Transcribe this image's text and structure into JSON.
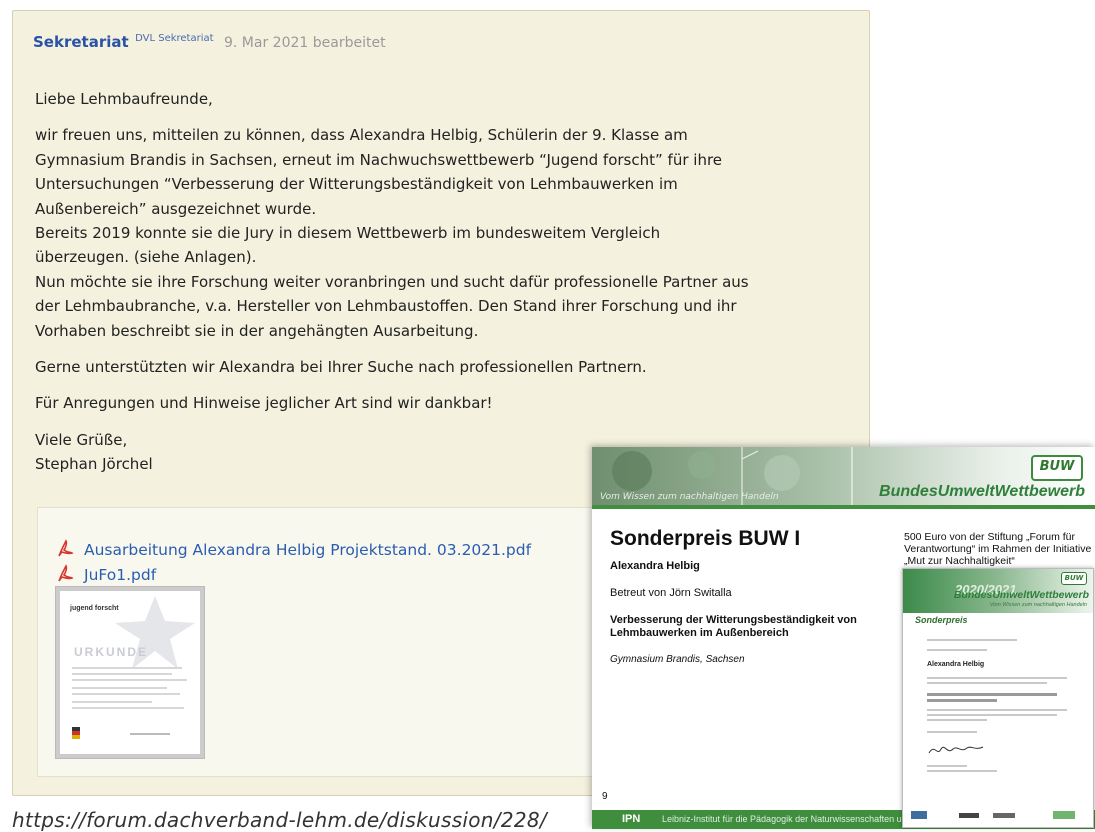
{
  "post": {
    "author": "Sekretariat",
    "role": "DVL Sekretariat",
    "date": "9. Mar 2021",
    "status": "bearbeitet",
    "greeting": "Liebe Lehmbaufreunde,",
    "lines": [
      "wir freuen uns, mitteilen zu können, dass Alexandra Helbig, Schülerin der 9. Klasse am",
      "Gymnasium Brandis in Sachsen, erneut im Nachwuchswettbewerb “Jugend forscht” für ihre",
      "Untersuchungen “Verbesserung der Witterungsbeständigkeit von Lehmbauwerken im",
      "Außenbereich” ausgezeichnet wurde.",
      "Bereits 2019 konnte sie die Jury in diesem Wettbewerb im bundesweitem Vergleich",
      "überzeugen. (siehe Anlagen).",
      "Nun möchte sie ihre Forschung weiter voranbringen und sucht dafür professionelle Partner aus",
      "der Lehmbaubranche, v.a. Hersteller von Lehmbaustoffen. Den Stand ihrer Forschung und ihr",
      "Vorhaben beschreibt sie in der angehängten Ausarbeitung."
    ],
    "support": "Gerne unterstützten wir Alexandra bei Ihrer Suche nach professionellen Partnern.",
    "thanks": "Für Anregungen und Hinweise jeglicher Art sind wir dankbar!",
    "closing": "Viele Grüße,",
    "signature": "Stephan Jörchel"
  },
  "attachments": {
    "files": [
      "Ausarbeitung Alexandra Helbig Projektstand. 03.2021.pdf",
      "JuFo1.pdf"
    ],
    "thumb": {
      "logo": "jugend forscht",
      "heading": "URKUNDE"
    }
  },
  "url": "https://forum.dachverband-lehm.de/diskussion/228/",
  "certificate": {
    "brand": "BundesUmweltWettbewerb",
    "logo": "BUW",
    "faint_text": "Vom Wissen zum nachhaltigen Handeln",
    "title": "Sonderpreis BUW I",
    "name": "Alexandra Helbig",
    "mentor": "Betreut von Jörn Switalla",
    "project": "Verbesserung der Witterungsbeständigkeit von Lehmbauwerken im Außenbereich",
    "school": "Gymnasium Brandis, Sachsen",
    "prize": "500 Euro von der Stiftung „Forum für Verantwortung“ im Rahmen der Initiative „Mut zur Nachhaltigkeit“",
    "page": "9",
    "footer_logo": "IPN",
    "footer_text": "Leibniz-Institut für die Pädagogik der Naturwissenschaften und Mathematik",
    "mini": {
      "year": "2020/2021",
      "logo": "BUW",
      "brand": "BundesUmweltWettbewerb",
      "tagline": "Vom Wissen zum nachhaltigen Handeln",
      "title": "Sonderpreis",
      "honoree": "Alexandra Helbig"
    }
  },
  "colors": {
    "post_bg": "#f4f1de",
    "link": "#2a5db0",
    "author": "#2a52a6",
    "buw_green": "#3e8e3e"
  },
  "icons": {
    "attachment": "pdf-icon"
  }
}
